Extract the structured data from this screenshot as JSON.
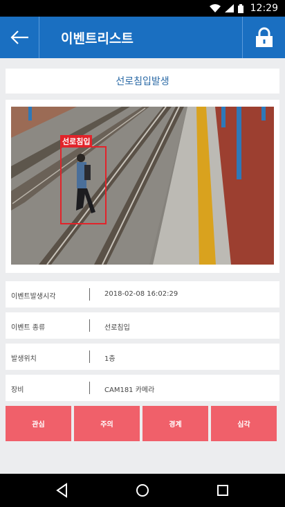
{
  "status_bar": {
    "time": "12:29",
    "icons": [
      "wifi-icon",
      "signal-icon",
      "battery-icon"
    ]
  },
  "app_bar": {
    "title": "이벤트리스트",
    "back_icon": "arrow-left-icon",
    "lock_icon": "lock-icon"
  },
  "event": {
    "type_title": "선로침입발생",
    "detection_label": "선로침입"
  },
  "details": [
    {
      "label": "이벤트발생시각",
      "value": "2018-02-08 16:02:29"
    },
    {
      "label": "이벤트 종류",
      "value": "선로침입"
    },
    {
      "label": "발생위치",
      "value": "1층"
    },
    {
      "label": "장비",
      "value": "CAM181 카메라"
    }
  ],
  "levels": [
    "관심",
    "주의",
    "경계",
    "심각"
  ],
  "nav": [
    "back-triangle-icon",
    "home-circle-icon",
    "recents-square-icon"
  ],
  "colors": {
    "app_bar": "#1a6fc1",
    "level_button": "#f0606a",
    "detect_box": "#e2232a"
  }
}
